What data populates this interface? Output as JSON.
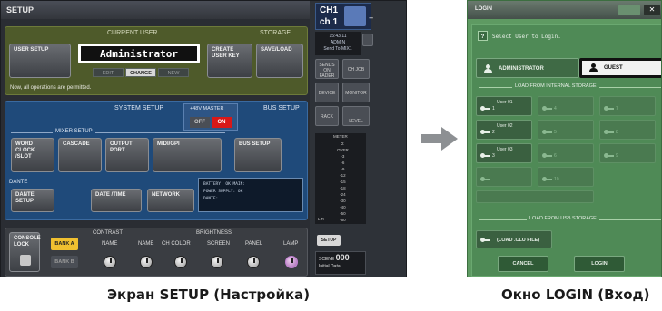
{
  "setup": {
    "title": "SETUP",
    "current_user_label": "CURRENT USER",
    "storage_label": "STORAGE",
    "user_setup_label": "USER SETUP",
    "current_user": "Administrator",
    "user_seg": [
      "EDIT",
      "CHANGE",
      "NEW"
    ],
    "create_user_key_label": "CREATE USER KEY",
    "save_load_label": "SAVE/LOAD",
    "status_message": "Now, all operations are permitted.",
    "system_setup_label": "SYSTEM SETUP",
    "master_label": "+48V MASTER",
    "off_label": "OFF",
    "on_label": "ON",
    "bus_setup_section_label": "BUS SETUP",
    "mixer_setup_label": "MIXER SETUP",
    "word_clock_label": "WORD CLOCK /SLOT",
    "cascade_label": "CASCADE",
    "output_port_label": "OUTPUT PORT",
    "midi_gpi_label": "MIDI/GPI",
    "bus_setup_label": "BUS SETUP",
    "dante_section_label": "DANTE",
    "dante_setup_label": "DANTE SETUP",
    "date_time_label": "DATE /TIME",
    "network_label": "NETWORK",
    "status_lines": [
      "BATTERY: OK MAIN:",
      "POWER SUPPLY: OK",
      "DANTE:"
    ],
    "console_lock_label": "CONSOLE LOCK",
    "bank_a_label": "BANK A",
    "bank_b_label": "BANK B",
    "contrast_label": "CONTRAST",
    "brightness_label": "BRIGHTNESS",
    "name_label_1": "NAME",
    "name_label_2": "NAME",
    "ch_color_label": "CH COLOR",
    "screen_label": "SCREEN",
    "panel_label": "PANEL",
    "lamp_label": "LAMP"
  },
  "side": {
    "ch_line1": "CH1",
    "ch_line2": "ch 1",
    "plus": "+",
    "time": "15:43:11",
    "user_short": "ADMIN",
    "send_to": "Send To MIX1",
    "sends_label": "SENDS ON FADER",
    "ch_job_label": "CH JOB",
    "device_label": "DEVICE",
    "monitor_label": "MONITOR",
    "rack_label": "RACK",
    "level_label": "LEVEL",
    "meter_label": "METER",
    "meter_ticks": [
      "Σ",
      "OVER",
      "-3",
      "-6",
      "-9",
      "-12",
      "-15",
      "-18",
      "-24",
      "-30",
      "-40",
      "-50",
      "-60"
    ],
    "meter_lr": "L  R",
    "setup_tab": "SETUP",
    "scene_label": "SCENE",
    "scene_number": "000",
    "scene_name": "Initial Data"
  },
  "login": {
    "title": "LOGIN",
    "help_text": "Select User to Login.",
    "admin_label": "ADMINISTRATOR",
    "guest_label": "GUEST",
    "internal_storage_label": "LOAD FROM INTERNAL STORAGE",
    "slots": [
      {
        "num": "1",
        "name": "User 01"
      },
      {
        "num": "2",
        "name": "User 02"
      },
      {
        "num": "3",
        "name": "User 03"
      }
    ],
    "empty_slot_numbers": [
      "4",
      "5",
      "6",
      "7",
      "8",
      "9",
      "10"
    ],
    "usb_storage_label": "LOAD FROM USB STORAGE",
    "load_clu_label": "(LOAD .CLU FILE)",
    "cancel_label": "CANCEL",
    "login_label": "LOGIN"
  },
  "captions": {
    "setup_screen": "Экран SETUP (Настройка)",
    "login_window": "Окно LOGIN (Вход)"
  }
}
